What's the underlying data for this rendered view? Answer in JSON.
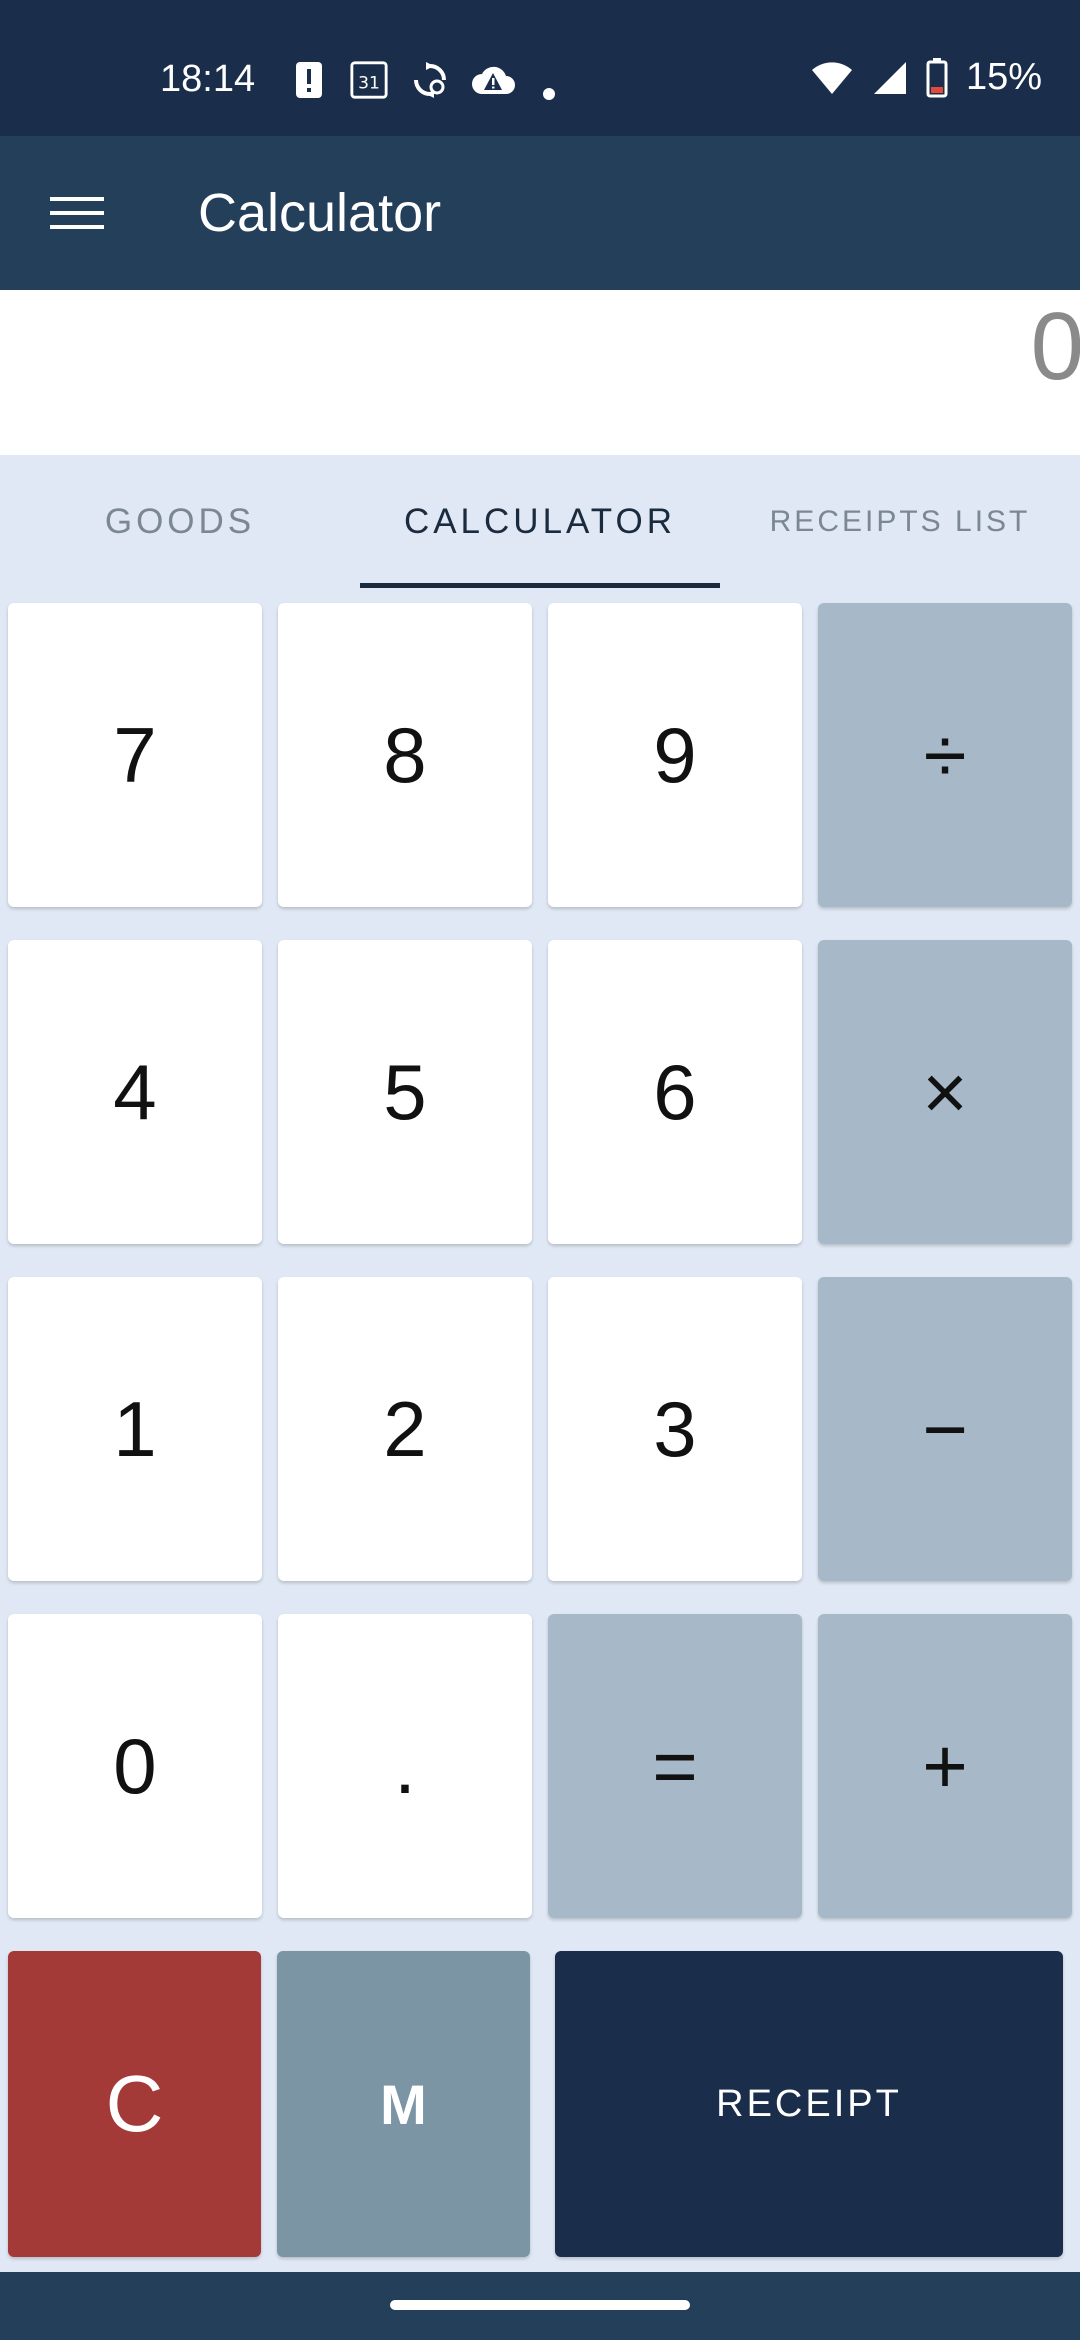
{
  "status_bar": {
    "time": "18:14",
    "battery_percent": "15%",
    "icons": [
      "alert-icon",
      "calendar-icon",
      "sync-icon",
      "cloud-warning-icon",
      "dot-icon",
      "wifi-icon",
      "signal-icon",
      "battery-low-icon"
    ],
    "calendar_day": "31"
  },
  "app_bar": {
    "title": "Calculator",
    "menu_icon": "hamburger-menu-icon"
  },
  "display": {
    "value": "0"
  },
  "tabs": [
    {
      "label": "GOODS",
      "active": false
    },
    {
      "label": "CALCULATOR",
      "active": true
    },
    {
      "label": "RECEIPTS LIST",
      "active": false
    }
  ],
  "keypad": {
    "rows": [
      [
        "7",
        "8",
        "9",
        "÷"
      ],
      [
        "4",
        "5",
        "6",
        "×"
      ],
      [
        "1",
        "2",
        "3",
        "−"
      ],
      [
        "0",
        ".",
        "=",
        "+"
      ]
    ],
    "clear_label": "C",
    "memory_label": "M",
    "receipt_label": "RECEIPT"
  },
  "colors": {
    "status_bar": "#1a2d4a",
    "app_bar": "#243f5a",
    "background": "#dfe8f4",
    "operator_key": "#a7b9c8",
    "clear_key": "#a33a38",
    "memory_key": "#7b95a4",
    "receipt_key": "#1a2d4a"
  }
}
